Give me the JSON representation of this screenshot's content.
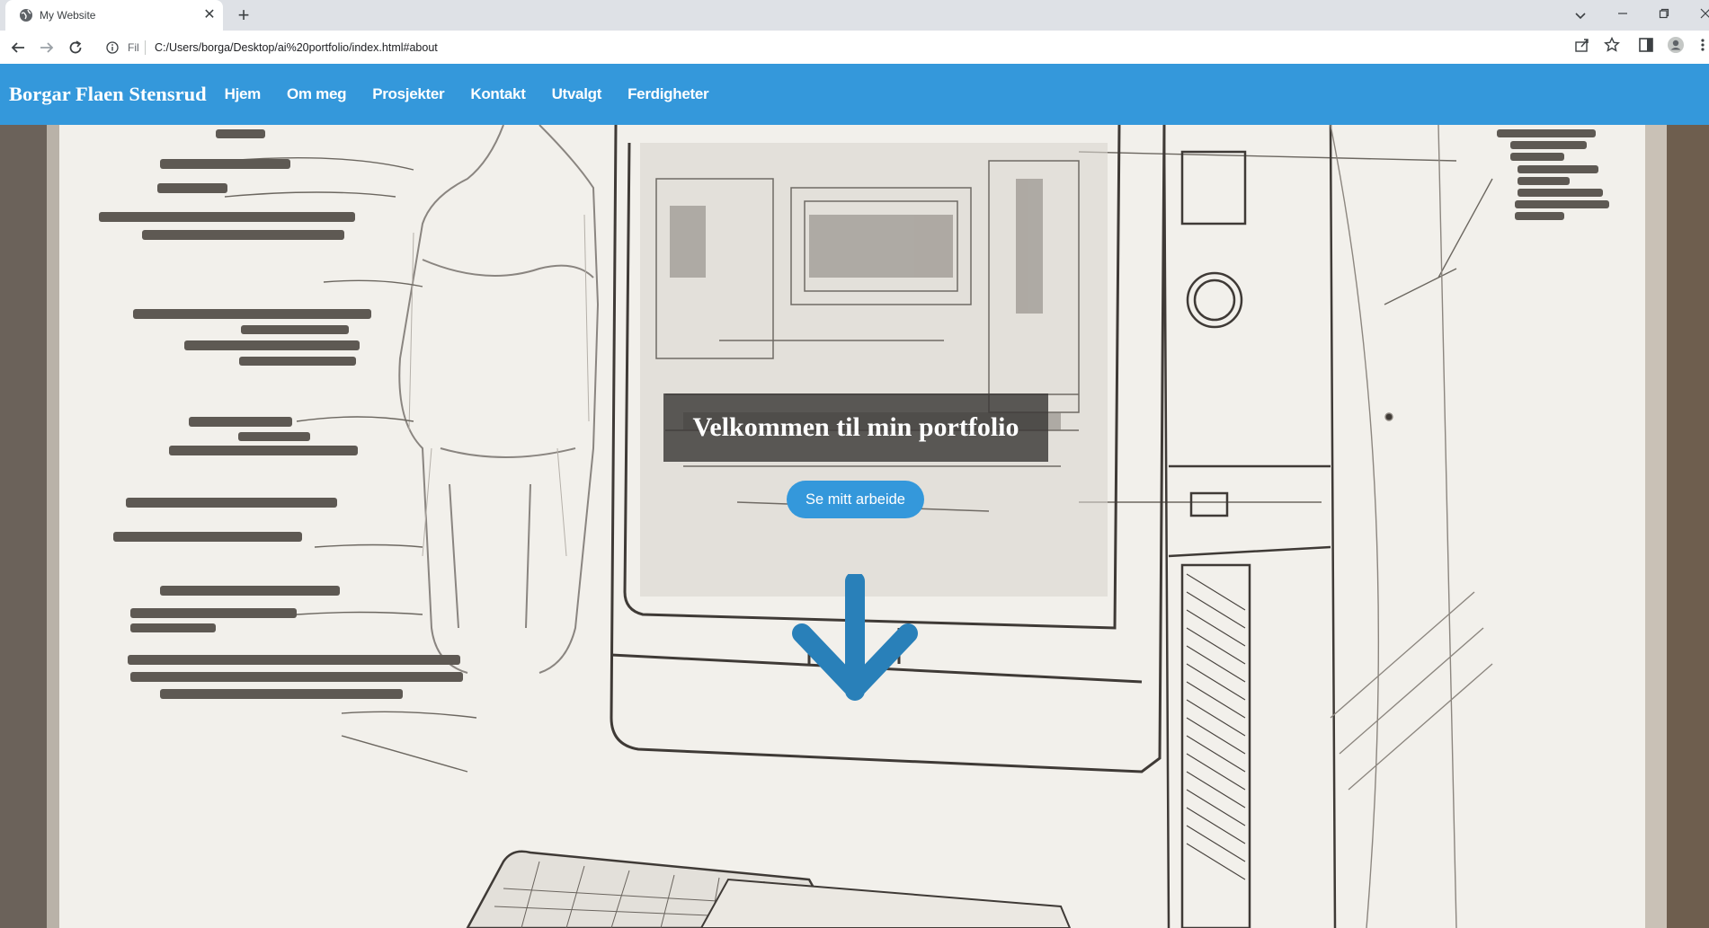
{
  "browser": {
    "tab": {
      "title": "My Website",
      "favicon": "globe-icon"
    },
    "address": {
      "scheme_label": "Fil",
      "url": "C:/Users/borga/Desktop/ai%20portfolio/index.html#about"
    },
    "icons": [
      "back-arrow-icon",
      "forward-arrow-icon",
      "reload-icon",
      "info-icon",
      "share-icon",
      "star-icon",
      "side-panel-icon",
      "profile-icon",
      "menu-icon",
      "tab-search-icon",
      "minimize-icon",
      "maximize-icon",
      "close-icon",
      "plus-icon"
    ]
  },
  "site": {
    "logo": "Borgar Flaen Stensrud",
    "nav": [
      {
        "label": "Hjem"
      },
      {
        "label": "Om meg"
      },
      {
        "label": "Prosjekter"
      },
      {
        "label": "Kontakt"
      },
      {
        "label": "Utvalgt"
      },
      {
        "label": "Ferdigheter"
      }
    ],
    "colors": {
      "header": "#3498db",
      "cta": "#3498db",
      "arrow": "#2980b9"
    }
  },
  "hero": {
    "title": "Velkommen til min portfolio",
    "cta_label": "Se mitt arbeide",
    "scroll_icon": "arrow-down-icon"
  }
}
